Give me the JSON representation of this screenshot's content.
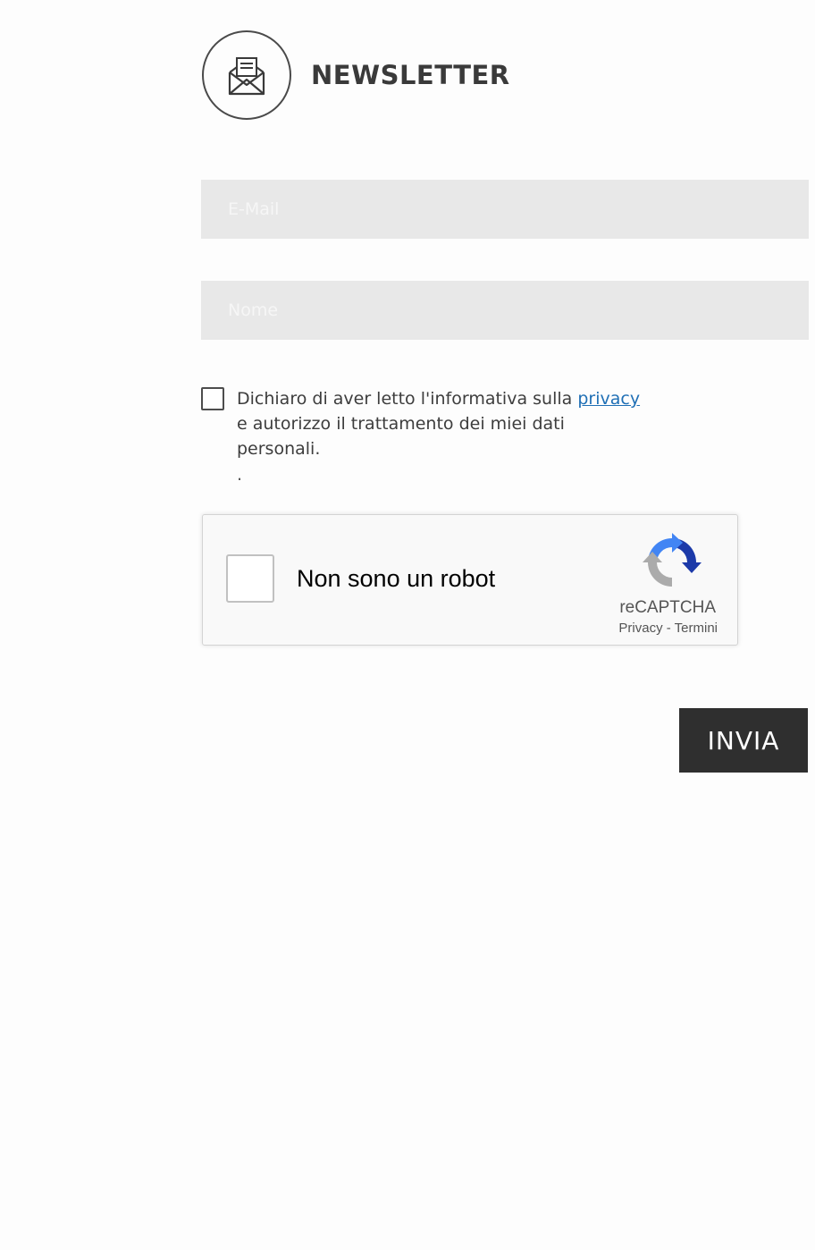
{
  "header": {
    "logo_icon": "envelope-newsletter-icon",
    "title": "NEWSLETTER"
  },
  "form": {
    "email_placeholder": "E-Mail",
    "name_placeholder": "Nome"
  },
  "consent": {
    "text_before": "Dichiaro di aver letto l'informativa sulla ",
    "link_label": "privacy",
    "text_after": " e autorizzo il trattamento dei miei dati personali.",
    "dot": "."
  },
  "recaptcha": {
    "label": "Non sono un robot",
    "brand": "reCAPTCHA",
    "privacy_link": "Privacy",
    "separator": " - ",
    "terms_link": "Termini",
    "logo_icon": "recaptcha-icon"
  },
  "submit_label": "INVIA",
  "colors": {
    "field_bg": "#e8e8e8",
    "button_bg": "#2f2f2f",
    "link": "#1f6fb5"
  }
}
